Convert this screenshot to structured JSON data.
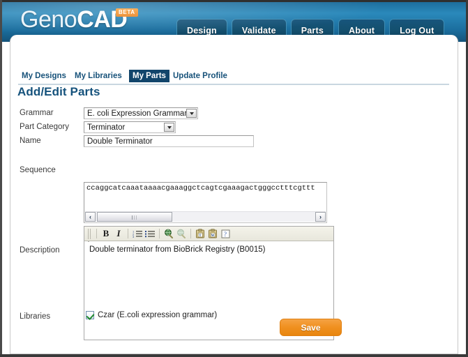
{
  "header": {
    "logo_geno": "Geno",
    "logo_cad": "CAD",
    "badge": "BETA",
    "nav": [
      {
        "label": "Design"
      },
      {
        "label": "Validate"
      },
      {
        "label": "Parts"
      },
      {
        "label": "About"
      },
      {
        "label": "Log Out"
      }
    ]
  },
  "tabs": [
    {
      "label": "My Designs",
      "active": false
    },
    {
      "label": "My Libraries",
      "active": false
    },
    {
      "label": "My Parts",
      "active": true
    },
    {
      "label": "Update Profile",
      "active": false
    }
  ],
  "page_title": "Add/Edit Parts",
  "form": {
    "grammar": {
      "label": "Grammar",
      "value": "E. coli Expression Grammar"
    },
    "part_category": {
      "label": "Part Category",
      "value": "Terminator"
    },
    "name": {
      "label": "Name",
      "value": "Double Terminator"
    },
    "sequence": {
      "label": "Sequence",
      "value": "ccaggcatcaaataaaacgaaaggctcagtcgaaagactgggcctttcgttt"
    },
    "description": {
      "label": "Description",
      "value": "Double terminator from BioBrick Registry (B0015)",
      "toolbar": [
        {
          "name": "bold-icon",
          "glyph": "B"
        },
        {
          "name": "italic-icon",
          "glyph": "I"
        },
        {
          "name": "ordered-list-icon",
          "glyph": ""
        },
        {
          "name": "unordered-list-icon",
          "glyph": ""
        },
        {
          "name": "insert-link-icon",
          "glyph": ""
        },
        {
          "name": "unlink-icon",
          "glyph": ""
        },
        {
          "name": "paste-as-plain-text-icon",
          "glyph": ""
        },
        {
          "name": "paste-from-word-icon",
          "glyph": ""
        },
        {
          "name": "help-icon",
          "glyph": "?"
        }
      ]
    },
    "libraries": {
      "label": "Libraries",
      "checkbox_label": "Czar (E.coli expression grammar)",
      "checked": true
    },
    "save_label": "Save"
  },
  "scrollbar": {
    "left_arrow": "‹",
    "right_arrow": "›"
  },
  "colors": {
    "header_blue": "#1d6d9c",
    "nav_blue": "#14506f",
    "title_blue": "#15527c",
    "active_tab": "#11456b",
    "accent_orange": "#f0901f",
    "beta_orange": "#e8811c"
  }
}
